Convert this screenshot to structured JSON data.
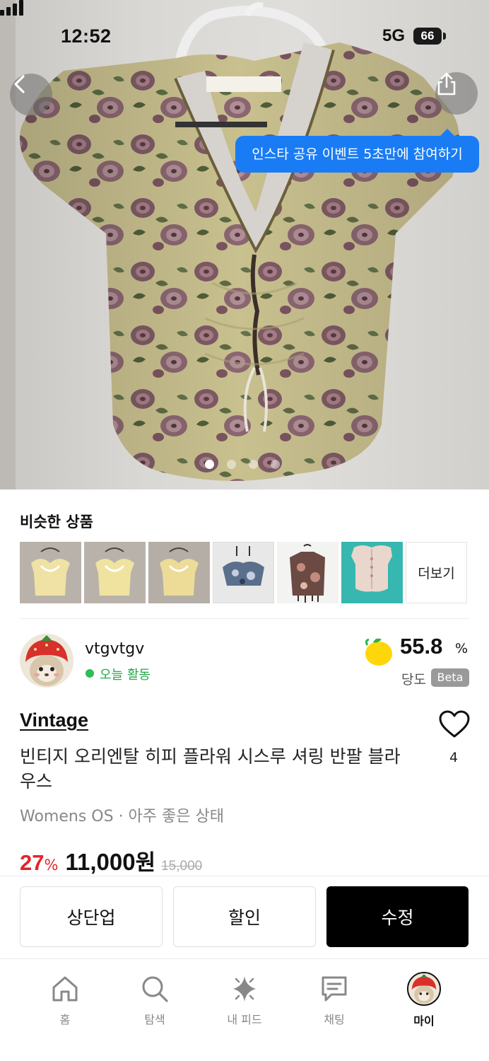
{
  "status_bar": {
    "time": "12:52",
    "network": "5G",
    "battery": "66"
  },
  "hero": {
    "share_tooltip": "인스타 공유 이벤트 5초만에 참여하기",
    "image_count": 4,
    "active_image": 1
  },
  "similar": {
    "title": "비슷한 상품",
    "more_label": "더보기",
    "items": [
      {
        "icon": "yellow-top-thumbnail"
      },
      {
        "icon": "yellow-top-thumbnail"
      },
      {
        "icon": "yellow-top-thumbnail"
      },
      {
        "icon": "blue-floral-top-thumbnail"
      },
      {
        "icon": "brown-floral-tee-thumbnail"
      },
      {
        "icon": "pink-lace-top-thumbnail"
      }
    ]
  },
  "seller": {
    "name": "vtgvtgv",
    "activity": "오늘 활동",
    "sweetness_value": "55.8",
    "sweetness_unit": "%",
    "sweetness_label": "당도",
    "beta_badge": "Beta"
  },
  "product": {
    "brand": "Vintage",
    "title": "빈티지 오리엔탈 히피 플라워 시스루 셔링 반팔 블라우스",
    "like_count": "4",
    "meta": "Womens OS · 아주 좋은 상태",
    "discount_value": "27",
    "discount_unit": "%",
    "price_value": "11,000",
    "price_unit": "원",
    "original_price": "15,000"
  },
  "actions": {
    "bump_label": "상단업",
    "discount_label": "할인",
    "edit_label": "수정"
  },
  "tabbar": {
    "home": "홈",
    "search": "탐색",
    "feed": "내 피드",
    "chat": "채팅",
    "my": "마이",
    "active": "my"
  },
  "colors": {
    "accent_blue": "#1a7cf5",
    "discount_red": "#e5242b",
    "active_green": "#2bbf55",
    "primary_black": "#000000"
  }
}
